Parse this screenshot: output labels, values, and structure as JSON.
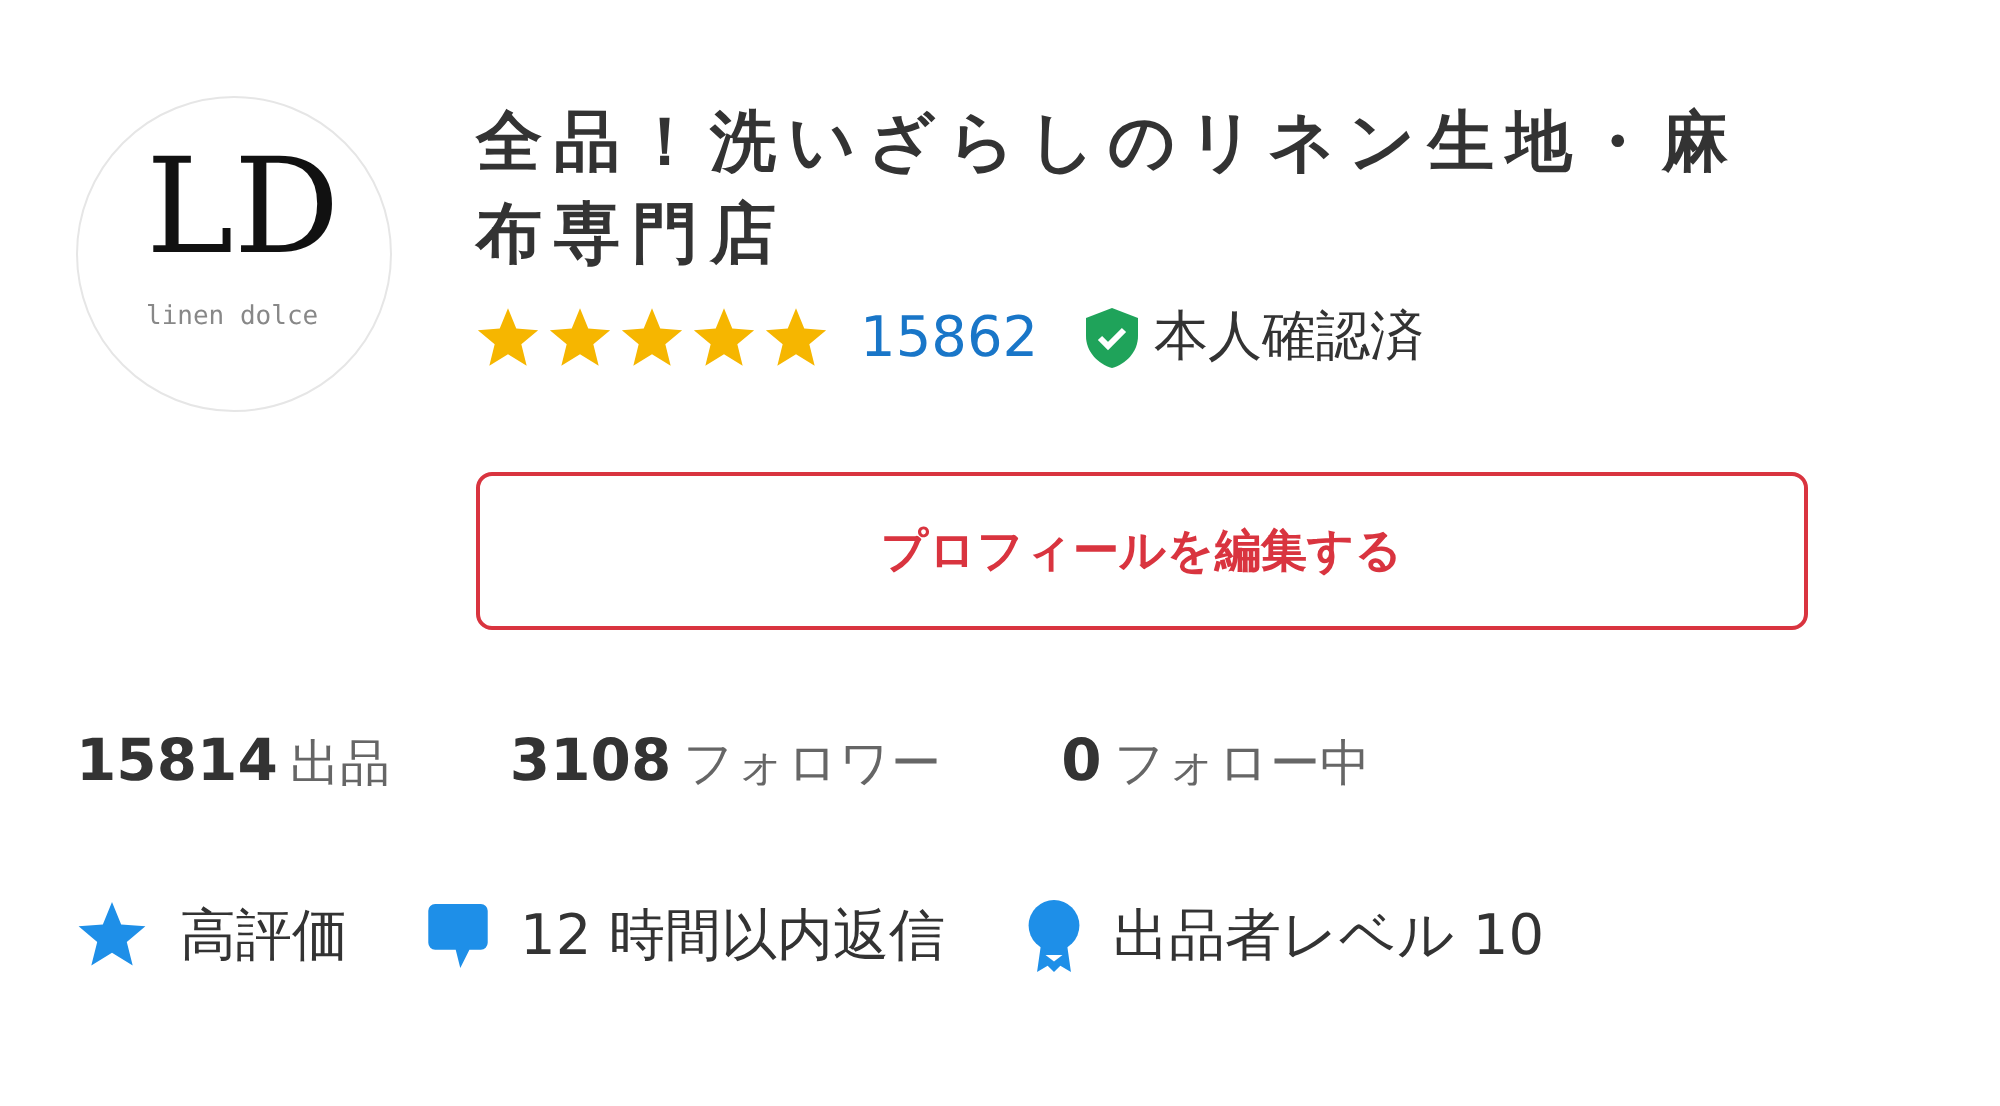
{
  "logo": {
    "letters": "LD",
    "caption": "linen dolce"
  },
  "shop_name": "全品！洗いざらしのリネン生地・麻布専門店",
  "rating": {
    "stars": 5,
    "count": "15862"
  },
  "verified": {
    "on": true,
    "label": "本人確認済"
  },
  "edit_button": {
    "label": "プロフィールを編集する"
  },
  "stats": [
    {
      "value": "15814",
      "label": "出品"
    },
    {
      "value": "3108",
      "label": "フォロワー"
    },
    {
      "value": "0",
      "label": "フォロー中"
    }
  ],
  "badges": [
    {
      "kind": "star",
      "label": "高評価"
    },
    {
      "kind": "chat",
      "label": "12 時間以内返信"
    },
    {
      "kind": "medal",
      "label": "出品者レベル 10"
    }
  ]
}
